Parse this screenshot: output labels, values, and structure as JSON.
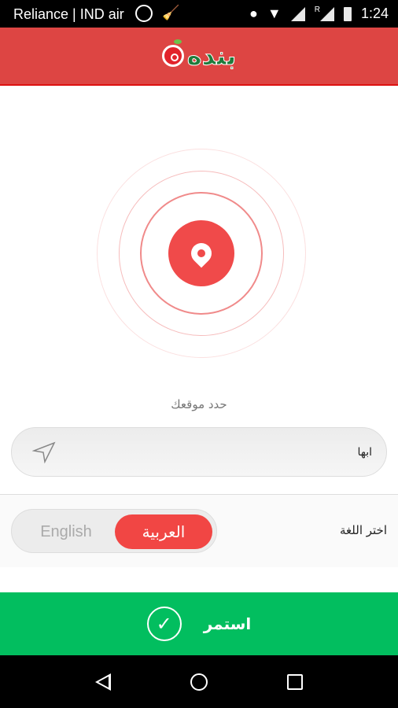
{
  "status_bar": {
    "carrier": "Reliance | IND air",
    "roaming": "R",
    "time": "1:24",
    "icons": [
      "whatsapp-icon",
      "cleaner-broom-icon",
      "location-icon",
      "wifi-icon",
      "signal-icon",
      "signal-roaming-icon",
      "battery-icon"
    ]
  },
  "header": {
    "logo_text": "بنده",
    "bg": "#dd4543"
  },
  "location": {
    "prompt": "حدد موقعك",
    "value": "ابها",
    "icon": "navigation-arrow-icon"
  },
  "language": {
    "label": "اختر اللغة",
    "options": [
      "English",
      "العربية"
    ],
    "selected": "العربية"
  },
  "continue": {
    "label": "استمر",
    "color": "#02be5f"
  },
  "nav": [
    "back",
    "home",
    "recents"
  ]
}
